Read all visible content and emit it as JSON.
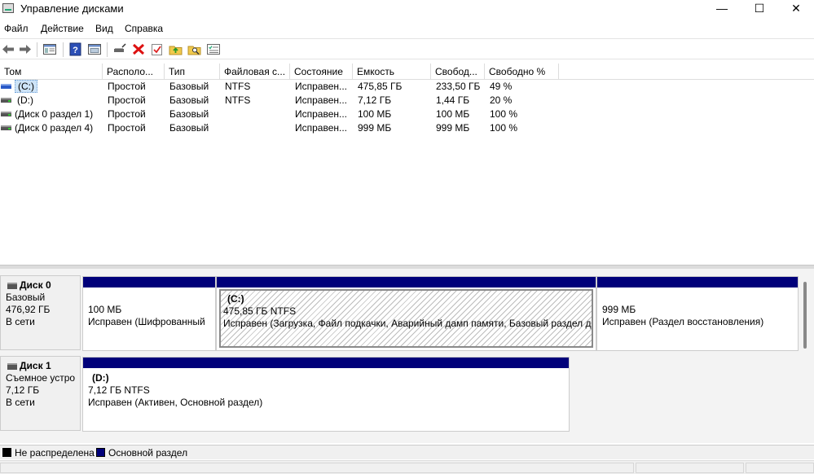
{
  "window": {
    "title": "Управление дисками",
    "min": "—",
    "max": "☐",
    "close": "✕"
  },
  "menu": [
    "Файл",
    "Действие",
    "Вид",
    "Справка"
  ],
  "toolbar_icons": [
    "back-icon",
    "forward-icon",
    "console-tree-icon",
    "help-icon",
    "properties-icon",
    "connect-icon",
    "delete-icon",
    "checkmark-icon",
    "up-folder-icon",
    "search-folder-icon",
    "list-view-icon"
  ],
  "volume_list": {
    "columns": [
      "Том",
      "Располо...",
      "Тип",
      "Файловая с...",
      "Состояние",
      "Емкость",
      "Свобод...",
      "Свободно %"
    ],
    "rows": [
      {
        "name": "(C:)",
        "layout": "Простой",
        "type": "Базовый",
        "fs": "NTFS",
        "status": "Исправен...",
        "capacity": "475,85 ГБ",
        "free": "233,50 ГБ",
        "free_pct": "49 %"
      },
      {
        "name": "(D:)",
        "layout": "Простой",
        "type": "Базовый",
        "fs": "NTFS",
        "status": "Исправен...",
        "capacity": "7,12 ГБ",
        "free": "1,44 ГБ",
        "free_pct": "20 %"
      },
      {
        "name": "(Диск 0 раздел 1)",
        "layout": "Простой",
        "type": "Базовый",
        "fs": "",
        "status": "Исправен...",
        "capacity": "100 МБ",
        "free": "100 МБ",
        "free_pct": "100 %"
      },
      {
        "name": "(Диск 0 раздел 4)",
        "layout": "Простой",
        "type": "Базовый",
        "fs": "",
        "status": "Исправен...",
        "capacity": "999 МБ",
        "free": "999 МБ",
        "free_pct": "100 %"
      }
    ]
  },
  "disks": [
    {
      "title": "Диск 0",
      "type": "Базовый",
      "size": "476,92 ГБ",
      "state": "В сети",
      "partitions": [
        {
          "name": "",
          "size": "100 МБ",
          "status": "Исправен (Шифрованный"
        },
        {
          "name": "(C:)",
          "size": "475,85 ГБ NTFS",
          "status": "Исправен (Загрузка, Файл подкачки, Аварийный дамп памяти, Базовый раздел ди"
        },
        {
          "name": "",
          "size": "999 МБ",
          "status": "Исправен (Раздел восстановления)"
        }
      ]
    },
    {
      "title": "Диск 1",
      "type": "Съемное устро",
      "size": "7,12 ГБ",
      "state": "В сети",
      "partitions": [
        {
          "name": "(D:)",
          "size": "7,12 ГБ NTFS",
          "status": "Исправен (Активен, Основной раздел)"
        }
      ]
    }
  ],
  "legend": {
    "unallocated": "Не распределена",
    "primary": "Основной раздел",
    "unallocated_color": "#000000",
    "primary_color": "#00007a"
  }
}
